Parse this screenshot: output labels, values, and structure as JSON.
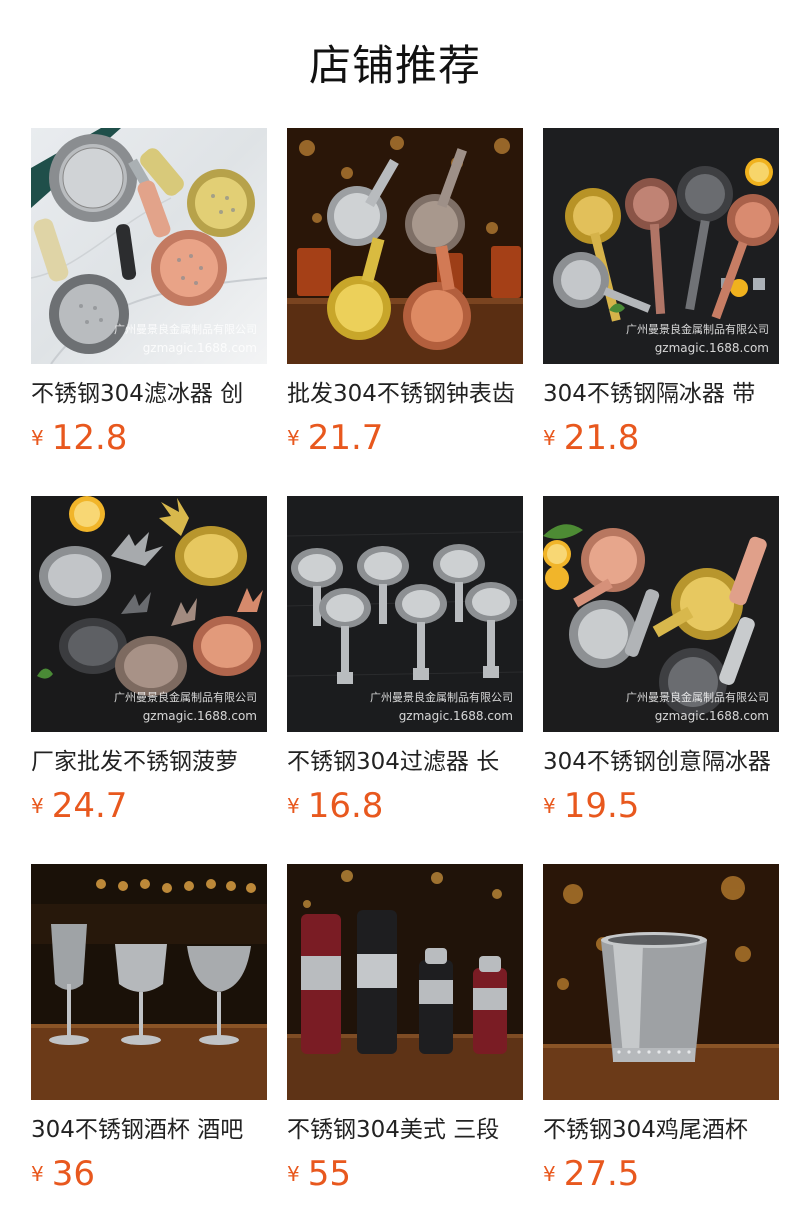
{
  "page": {
    "title": "店铺推荐"
  },
  "currency_symbol": "¥",
  "watermark": {
    "company": "广州曼景良金属制品有限公司",
    "site": "gzmagic.1688.com"
  },
  "colors": {
    "price": "#e8581e",
    "title": "#111111",
    "text": "#222222",
    "background": "#ffffff"
  },
  "products": [
    {
      "name": "不锈钢304滤冰器 创",
      "price": "12.8",
      "image": "cocktail-strainers-light-marble"
    },
    {
      "name": "批发304不锈钢钟表齿",
      "price": "21.7",
      "image": "clock-gear-strainers-bar"
    },
    {
      "name": "304不锈钢隔冰器 带",
      "price": "21.8",
      "image": "ornate-strainers-dark"
    },
    {
      "name": "厂家批发不锈钢菠萝",
      "price": "24.7",
      "image": "pineapple-strainers-dark"
    },
    {
      "name": "不锈钢304过滤器 长",
      "price": "16.8",
      "image": "long-handle-strainers-dark"
    },
    {
      "name": "304不锈钢创意隔冰器",
      "price": "19.5",
      "image": "creative-strainers-dark"
    },
    {
      "name": "304不锈钢酒杯 酒吧",
      "price": "36",
      "image": "steel-wine-cups-bar"
    },
    {
      "name": "不锈钢304美式 三段",
      "price": "55",
      "image": "cocktail-shakers-bar"
    },
    {
      "name": "不锈钢304鸡尾酒杯",
      "price": "27.5",
      "image": "julep-cup-bar"
    }
  ]
}
